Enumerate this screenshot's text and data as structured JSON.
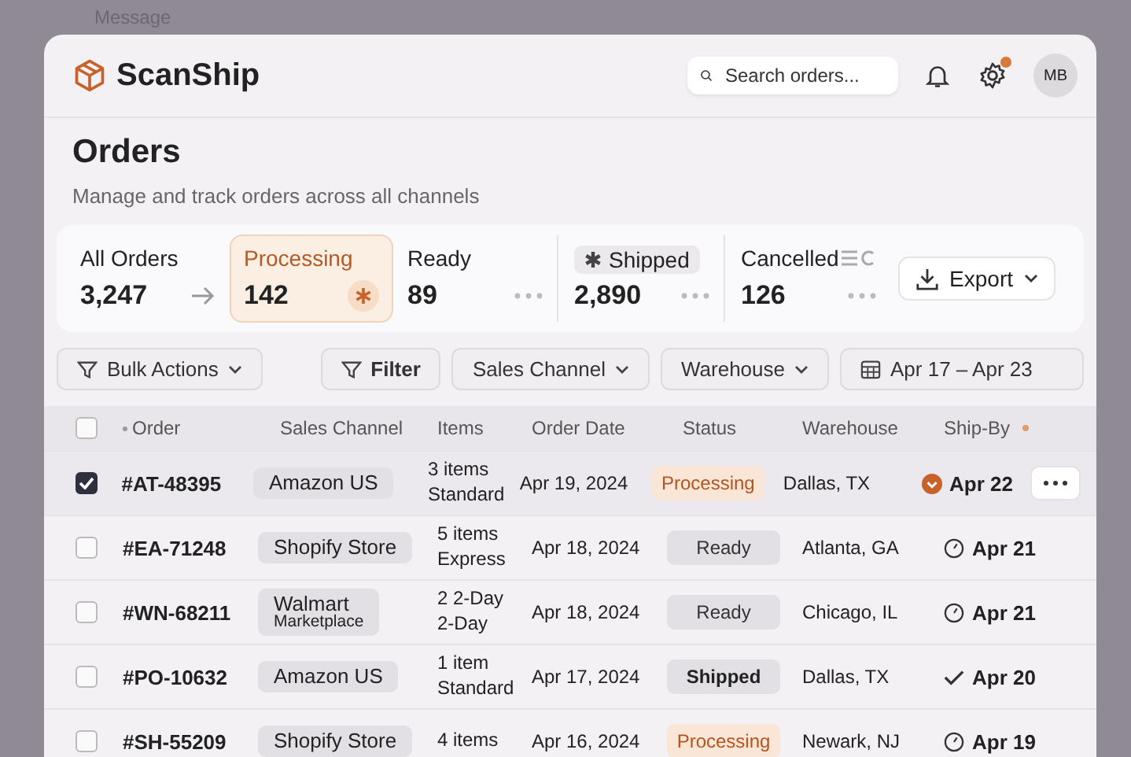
{
  "background": {
    "label": "Message"
  },
  "header": {
    "brand": "ScanShip",
    "search": {
      "placeholder": "Search orders..."
    },
    "settings_alert": true,
    "avatar": "MB"
  },
  "page": {
    "title": "Orders",
    "subtitle": "Manage and track orders across all channels"
  },
  "stats": [
    {
      "label": "All Orders",
      "value": "3,247",
      "kind": "link",
      "selected": false
    },
    {
      "label": "Processing",
      "value": "142",
      "kind": "flagged",
      "selected": true
    },
    {
      "label": "Ready",
      "value": "89",
      "kind": "more",
      "selected": false
    },
    {
      "label": "Shipped",
      "value": "2,890",
      "kind": "tagged",
      "selected": false
    },
    {
      "label": "Cancelled",
      "value": "126",
      "kind": "listed",
      "selected": false
    }
  ],
  "export_button": "Export",
  "filters": {
    "bulk": "Bulk Actions",
    "filter": "Filter",
    "channel": "Sales Channel",
    "warehouse": "Warehouse",
    "dates": "Apr 17 – Apr 23"
  },
  "table": {
    "columns": [
      "Order",
      "Sales Channel",
      "Items",
      "Order Date",
      "Status",
      "Warehouse",
      "Ship-By"
    ],
    "select_all_checked": false,
    "rows": [
      {
        "selected": true,
        "order": "#AT-48395",
        "channel": "Amazon US",
        "items": "3 items",
        "shipping": "Standard",
        "date": "Apr 19, 2024",
        "status": {
          "label": "Processing",
          "kind": "processing"
        },
        "warehouse": "Dallas, TX",
        "ship_by": {
          "date": "Apr 22",
          "kind": "urgent"
        }
      },
      {
        "selected": false,
        "order": "#EA-71248",
        "channel": "Shopify Store",
        "items": "5 items",
        "shipping": "Express",
        "date": "Apr 18, 2024",
        "status": {
          "label": "Ready",
          "kind": "ready"
        },
        "warehouse": "Atlanta, GA",
        "ship_by": {
          "date": "Apr 21",
          "kind": "clock"
        }
      },
      {
        "selected": false,
        "order": "#WN-68211",
        "channel": "Walmart",
        "channel_sub": "Marketplace",
        "items": "2 2-Day",
        "shipping": "2-Day",
        "date": "Apr 18, 2024",
        "status": {
          "label": "Ready",
          "kind": "ready"
        },
        "warehouse": "Chicago, IL",
        "ship_by": {
          "date": "Apr 21",
          "kind": "clock"
        }
      },
      {
        "selected": false,
        "order": "#PO-10632",
        "channel": "Amazon US",
        "items": "1 item",
        "shipping": "Standard",
        "date": "Apr 17, 2024",
        "status": {
          "label": "Shipped",
          "kind": "shipped"
        },
        "warehouse": "Dallas, TX",
        "ship_by": {
          "date": "Apr 20",
          "kind": "check"
        }
      },
      {
        "selected": false,
        "order": "#SH-55209",
        "channel": "Shopify Store",
        "items": "4 items",
        "date": "Apr 16, 2024",
        "status": {
          "label": "Processing",
          "kind": "processing"
        },
        "warehouse": "Newark, NJ",
        "ship_by": {
          "date": "Apr 19",
          "kind": "clock"
        }
      }
    ]
  }
}
